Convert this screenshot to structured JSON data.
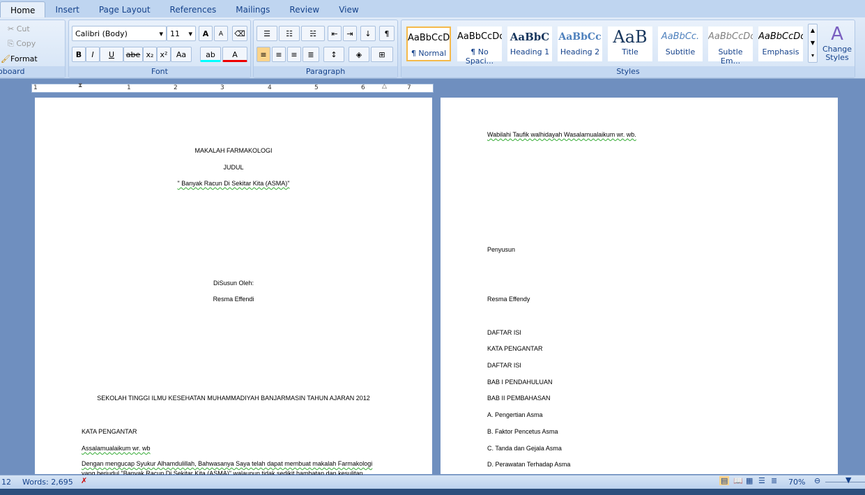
{
  "tabs": [
    "Home",
    "Insert",
    "Page Layout",
    "References",
    "Mailings",
    "Review",
    "View"
  ],
  "clipboard": {
    "cut": "Cut",
    "copy": "Copy",
    "format_painter": "Format Painter",
    "label": "oboard"
  },
  "font": {
    "name": "Calibri (Body)",
    "size": "11",
    "label": "Font",
    "bold": "B",
    "italic": "I",
    "underline": "U",
    "strike": "abe",
    "sub": "x₂",
    "sup": "x²",
    "case": "Aa",
    "grow": "A",
    "shrink": "A",
    "color": "A",
    "highlight": "ab"
  },
  "paragraph": {
    "label": "Paragraph",
    "pilcrow": "¶"
  },
  "styles": {
    "label": "Styles",
    "items": [
      {
        "sample": "AaBbCcDc",
        "name": "¶ Normal"
      },
      {
        "sample": "AaBbCcDc",
        "name": "¶ No Spaci..."
      },
      {
        "sample": "AaBbC",
        "name": "Heading 1"
      },
      {
        "sample": "AaBbCc",
        "name": "Heading 2"
      },
      {
        "sample": "AaB",
        "name": "Title"
      },
      {
        "sample": "AaBbCc.",
        "name": "Subtitle"
      },
      {
        "sample": "AaBbCcDc",
        "name": "Subtle Em..."
      },
      {
        "sample": "AaBbCcDc",
        "name": "Emphasis"
      }
    ],
    "change": "Change Styles"
  },
  "ruler": [
    "1",
    "1",
    "2",
    "3",
    "4",
    "5",
    "6",
    "7"
  ],
  "page1": {
    "lines": [
      "MAKALAH FARMAKOLOGI",
      "JUDUL",
      "\" Banyak Racun Di Sekitar Kita (ASMA)\"",
      "DiSusun Oleh:",
      "Resma Effendi",
      "SEKOLAH TINGGI ILMU KESEHATAN MUHAMMADIYAH BANJARMASIN TAHUN AJARAN 2012",
      "KATA PENGANTAR",
      "Assalamualaikum wr. wb",
      "Dengan mengucap Syukur Alhamdulillah,  Bahwasanya Saya telah dapat membuat makalah Farmakologi",
      "yang berjudul \"Banyak Racun Di Sekitar Kita (ASMA)\" walaupun tidak sedikit hambatan dan kesulitan"
    ]
  },
  "page2": {
    "lines": [
      "Wabilahi Taufik walhidayah Wasalamualaikum wr. wb.",
      "Penyusun",
      "Resma Effendy",
      "DAFTAR ISI",
      "KATA PENGANTAR",
      "DAFTAR ISI",
      "BAB I PENDAHULUAN",
      "BAB II PEMBAHASAN",
      "A.    Pengertian Asma",
      "B.    Faktor Pencetus  Asma",
      "C.    Tanda dan Gejala  Asma",
      "D.    Perawatan Terhadap Asma"
    ]
  },
  "status": {
    "page": "12",
    "words": "Words: 2,695",
    "zoom": "70%"
  },
  "zoom_level": 70
}
